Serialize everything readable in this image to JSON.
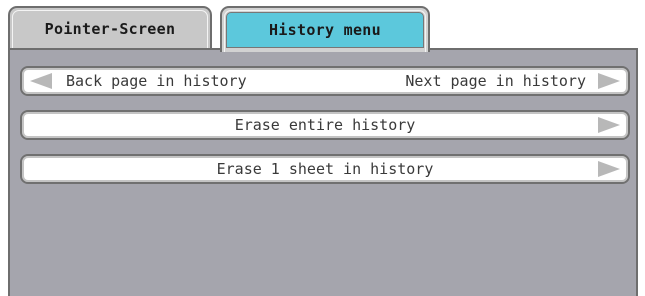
{
  "tabs": {
    "pointer_screen": "Pointer-Screen",
    "history_menu": "History menu"
  },
  "rows": {
    "back_page": "Back page in history",
    "next_page": "Next page in history",
    "erase_entire": "Erase entire history",
    "erase_one": "Erase 1 sheet in history"
  },
  "colors": {
    "active_tab": "#5cc8dc",
    "panel": "#a5a5ad"
  }
}
